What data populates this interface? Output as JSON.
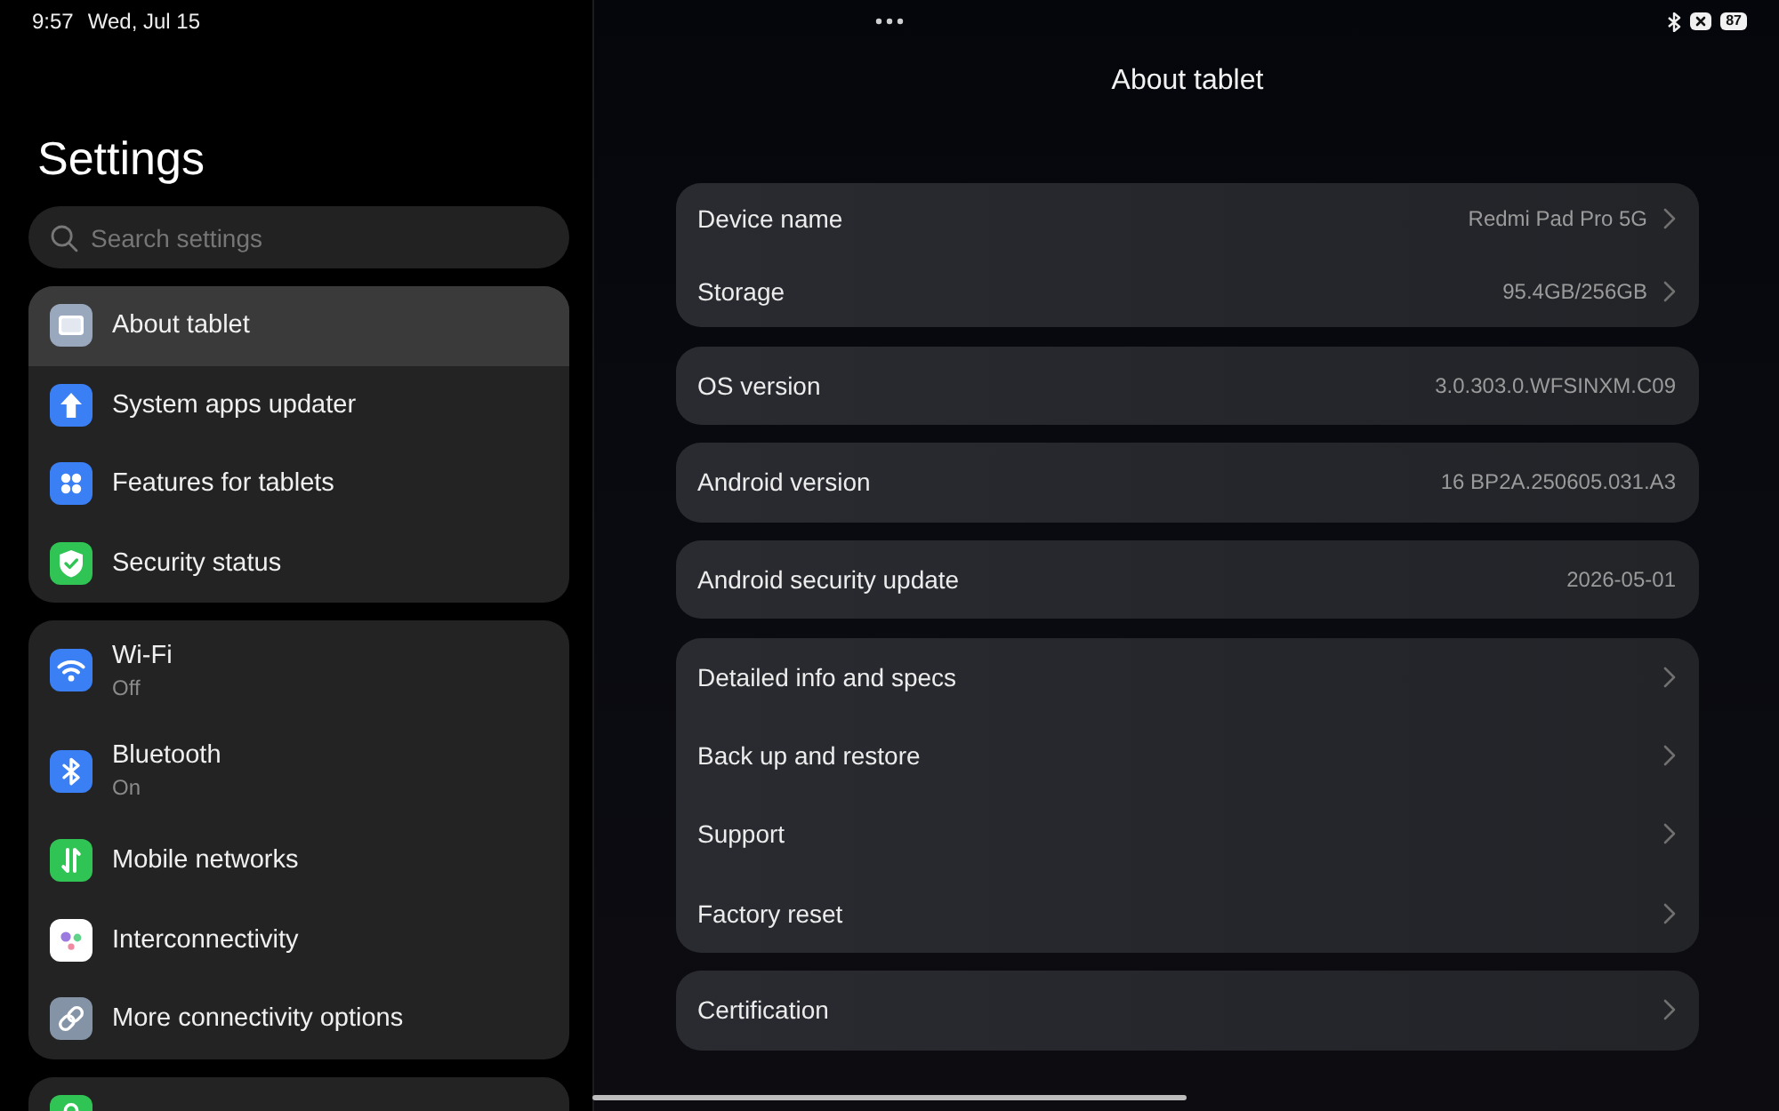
{
  "status_bar": {
    "time": "9:57",
    "date": "Wed, Jul 15",
    "battery": "87"
  },
  "sidebar": {
    "title": "Settings",
    "search": {
      "placeholder": "Search settings"
    },
    "groups": [
      {
        "items": [
          {
            "label": "About tablet",
            "color": "#9aa8bd",
            "selected": true
          },
          {
            "label": "System apps updater",
            "color": "#3a7ff4",
            "selected": false
          },
          {
            "label": "Features for tablets",
            "color": "#3a7ff4",
            "selected": false
          },
          {
            "label": "Security status",
            "color": "#2fc454",
            "selected": false
          }
        ]
      },
      {
        "items": [
          {
            "label": "Wi-Fi",
            "status": "Off",
            "color": "#3a7ff4",
            "selected": false
          },
          {
            "label": "Bluetooth",
            "status": "On",
            "color": "#3a7ff4",
            "selected": false
          },
          {
            "label": "Mobile networks",
            "color": "#2fc454",
            "selected": false
          },
          {
            "label": "Interconnectivity",
            "color": "#ffffff",
            "selected": false
          },
          {
            "label": "More connectivity options",
            "color": "#8593a6",
            "selected": false
          }
        ]
      },
      {
        "items": [
          {
            "color": "#2fc454",
            "selected": false
          }
        ]
      }
    ]
  },
  "page": {
    "title": "About tablet",
    "groups": [
      {
        "rows": [
          {
            "label": "Device name",
            "value": "Redmi Pad Pro 5G",
            "chevron": true
          },
          {
            "label": "Storage",
            "value": "95.4GB/256GB",
            "chevron": true
          }
        ]
      },
      {
        "rows": [
          {
            "label": "OS version",
            "value": "3.0.303.0.WFSINXM.C09",
            "chevron": false
          }
        ]
      },
      {
        "rows": [
          {
            "label": "Android version",
            "value": "16 BP2A.250605.031.A3",
            "chevron": false
          }
        ]
      },
      {
        "rows": [
          {
            "label": "Android security update",
            "value": "2026-05-01",
            "chevron": false
          }
        ]
      },
      {
        "rows": [
          {
            "label": "Detailed info and specs",
            "chevron": true
          },
          {
            "label": "Back up and restore",
            "chevron": true
          },
          {
            "label": "Support",
            "chevron": true
          },
          {
            "label": "Factory reset",
            "chevron": true
          }
        ]
      },
      {
        "rows": [
          {
            "label": "Certification",
            "chevron": true
          }
        ]
      }
    ]
  }
}
